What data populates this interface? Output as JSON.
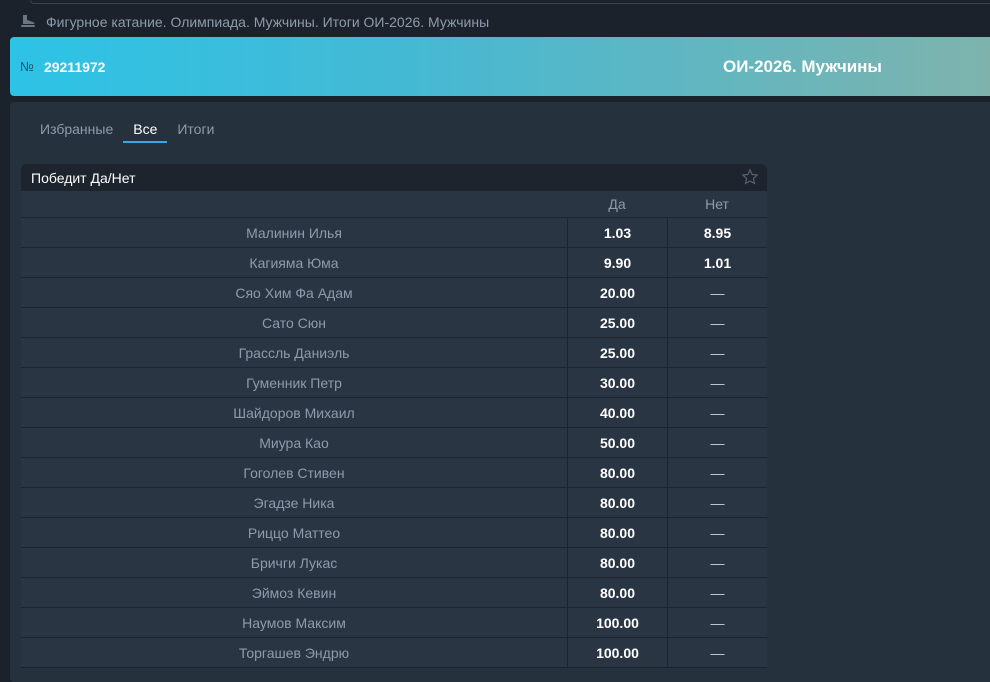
{
  "breadcrumb": {
    "text": "Фигурное катание. Олимпиада. Мужчины. Итоги  ОИ-2026. Мужчины",
    "icon": "skate-icon"
  },
  "hero": {
    "no_label": "№",
    "event_id": "29211972",
    "title": "ОИ-2026. Мужчины"
  },
  "tabs": [
    {
      "label": "Избранные"
    },
    {
      "label": "Все",
      "active": true
    },
    {
      "label": "Итоги"
    }
  ],
  "market": {
    "title": "Победит Да/Нет",
    "col_yes": "Да",
    "col_no": "Нет",
    "rows": [
      {
        "name": "Малинин Илья",
        "yes": "1.03",
        "no": "8.95"
      },
      {
        "name": "Кагияма Юма",
        "yes": "9.90",
        "no": "1.01"
      },
      {
        "name": "Сяо Хим Фа Адам",
        "yes": "20.00",
        "no": "—"
      },
      {
        "name": "Сато Сюн",
        "yes": "25.00",
        "no": "—"
      },
      {
        "name": "Грассль Даниэль",
        "yes": "25.00",
        "no": "—"
      },
      {
        "name": "Гуменник Петр",
        "yes": "30.00",
        "no": "—"
      },
      {
        "name": "Шайдоров Михаил",
        "yes": "40.00",
        "no": "—"
      },
      {
        "name": "Миура Као",
        "yes": "50.00",
        "no": "—"
      },
      {
        "name": "Гоголев Стивен",
        "yes": "80.00",
        "no": "—"
      },
      {
        "name": "Эгадзе Ника",
        "yes": "80.00",
        "no": "—"
      },
      {
        "name": "Риццо Маттео",
        "yes": "80.00",
        "no": "—"
      },
      {
        "name": "Бричги Лукас",
        "yes": "80.00",
        "no": "—"
      },
      {
        "name": "Эймоз Кевин",
        "yes": "80.00",
        "no": "—"
      },
      {
        "name": "Наумов Максим",
        "yes": "100.00",
        "no": "—"
      },
      {
        "name": "Торгашев Эндрю",
        "yes": "100.00",
        "no": "—"
      }
    ]
  }
}
